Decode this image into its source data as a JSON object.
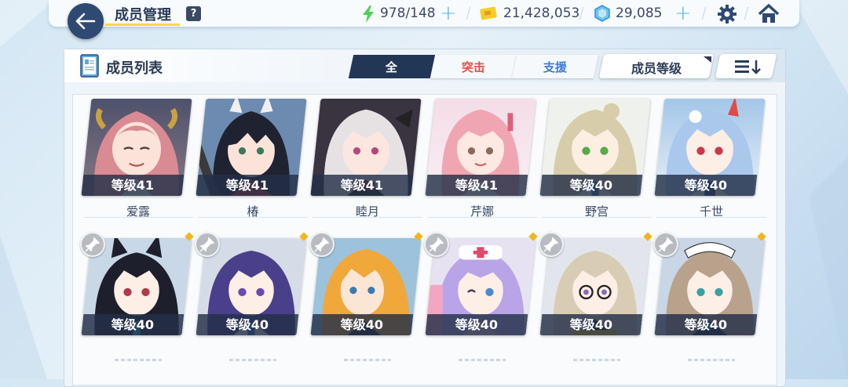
{
  "header": {
    "title": "成员管理",
    "help_label": "?",
    "stamina": "978/148",
    "credits": "21,428,053",
    "gems": "29,085",
    "plus": "+"
  },
  "panel": {
    "title": "成员列表",
    "tabs": [
      {
        "label": "全",
        "color": "#ffffff",
        "bg": "#223755"
      },
      {
        "label": "突击",
        "color": "#e0504a",
        "bg": "#f6f9fb"
      },
      {
        "label": "支援",
        "color": "#3e7bd4",
        "bg": "#f6f9fb"
      }
    ],
    "sort_label": "成员等级"
  },
  "members": [
    {
      "level": "等级41",
      "name": "爱露",
      "art": "pinkhorn"
    },
    {
      "level": "等级41",
      "name": "椿",
      "art": "blackhair"
    },
    {
      "level": "等级41",
      "name": "睦月",
      "art": "whitehair"
    },
    {
      "level": "等级41",
      "name": "芹娜",
      "art": "pinknurse"
    },
    {
      "level": "等级40",
      "name": "野宫",
      "art": "blonde"
    },
    {
      "level": "等级40",
      "name": "千世",
      "art": "bluehair"
    },
    {
      "level": "等级40",
      "name": "",
      "art": "catgirl"
    },
    {
      "level": "等级40",
      "name": "",
      "art": "purplehair"
    },
    {
      "level": "等级40",
      "name": "",
      "art": "orangehair"
    },
    {
      "level": "等级40",
      "name": "",
      "art": "lavender"
    },
    {
      "level": "等级40",
      "name": "",
      "art": "glasses"
    },
    {
      "level": "等级40",
      "name": "",
      "art": "maid"
    }
  ],
  "colors": {
    "accent": "#2e4a73",
    "highlight": "#f5d74a",
    "plus": "#58b4e8"
  },
  "icons": [
    "back-arrow-icon",
    "stamina-bolt-icon",
    "credit-card-icon",
    "gem-icon",
    "gear-icon",
    "home-icon",
    "sort-list-icon",
    "pin-icon"
  ]
}
